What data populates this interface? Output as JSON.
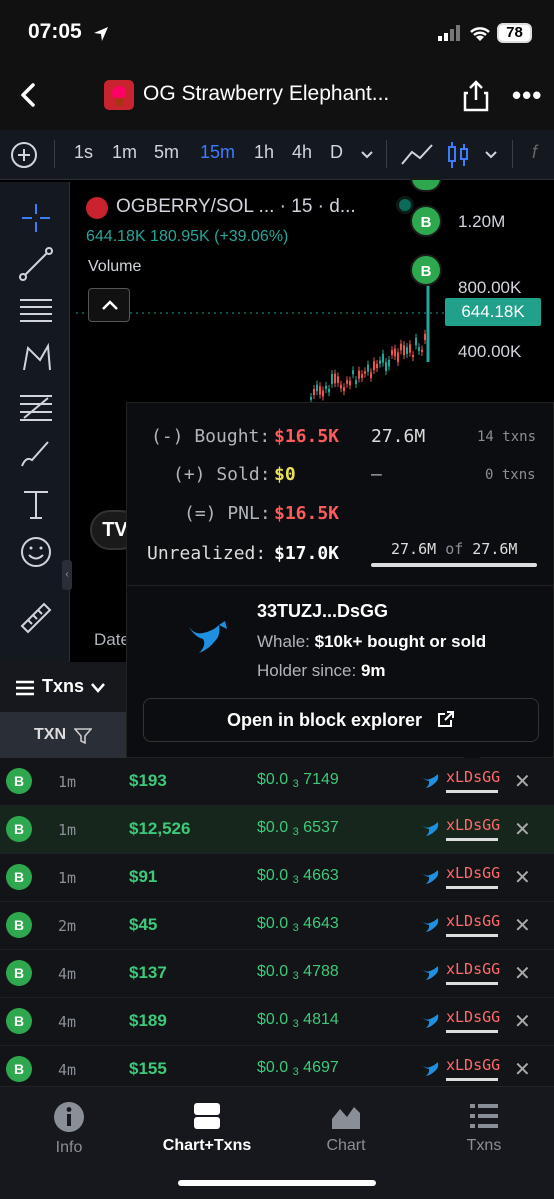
{
  "status_bar": {
    "time": "07:05",
    "battery": "78"
  },
  "header": {
    "title": "OG Strawberry Elephant..."
  },
  "toolbar": {
    "intervals": [
      "1s",
      "1m",
      "5m",
      "15m",
      "1h",
      "4h",
      "D"
    ],
    "active_interval": "15m"
  },
  "chart": {
    "pair_title": "OGBERRY/SOL ... · 15 · d...",
    "ohlc_text": "644.18K  180.95K (+39.06%)",
    "volume_label": "Volume",
    "y_labels": [
      "1.20M",
      "800.00K",
      "400.00K"
    ],
    "last_price": "644.18K",
    "buy_marker_label": "B",
    "date_label": "Date",
    "tv_logo": "TV"
  },
  "popup": {
    "bought_label": "(-) Bought:",
    "bought_value": "$16.5K",
    "bought_tokens": "27.6M",
    "bought_txns": "14 txns",
    "sold_label": "(+) Sold:",
    "sold_value": "$0",
    "sold_tokens": "–",
    "sold_txns": "0 txns",
    "pnl_label": "(=) PNL:",
    "pnl_value": "$16.5K",
    "unrealized_label": "Unrealized:",
    "unrealized_value": "$17.0K",
    "holding_a": "27.6M",
    "holding_of": "of",
    "holding_b": "27.6M",
    "address": "33TUZJ...DsGG",
    "whale_prefix": "Whale: ",
    "whale_value": "$10k+ bought or sold",
    "holder_prefix": "Holder since: ",
    "holder_value": "9m",
    "explorer_button": "Open in block explorer"
  },
  "txns": {
    "tab_label": "Txns",
    "column_label": "TXN",
    "rows": [
      {
        "type": "B",
        "age": "1m",
        "amount": "$193",
        "price_pre": "$0.0",
        "price_sub": "3",
        "price_post": "7149",
        "maker": "xLDsGG"
      },
      {
        "type": "B",
        "age": "1m",
        "amount": "$12,526",
        "price_pre": "$0.0",
        "price_sub": "3",
        "price_post": "6537",
        "maker": "xLDsGG"
      },
      {
        "type": "B",
        "age": "1m",
        "amount": "$91",
        "price_pre": "$0.0",
        "price_sub": "3",
        "price_post": "4663",
        "maker": "xLDsGG"
      },
      {
        "type": "B",
        "age": "2m",
        "amount": "$45",
        "price_pre": "$0.0",
        "price_sub": "3",
        "price_post": "4643",
        "maker": "xLDsGG"
      },
      {
        "type": "B",
        "age": "4m",
        "amount": "$137",
        "price_pre": "$0.0",
        "price_sub": "3",
        "price_post": "4788",
        "maker": "xLDsGG"
      },
      {
        "type": "B",
        "age": "4m",
        "amount": "$189",
        "price_pre": "$0.0",
        "price_sub": "3",
        "price_post": "4814",
        "maker": "xLDsGG"
      },
      {
        "type": "B",
        "age": "4m",
        "amount": "$155",
        "price_pre": "$0.0",
        "price_sub": "3",
        "price_post": "4697",
        "maker": "xLDsGG"
      }
    ]
  },
  "bottom_nav": {
    "items": [
      "Info",
      "Chart+Txns",
      "Chart",
      "Txns"
    ],
    "active": "Chart+Txns"
  },
  "colors": {
    "buy_green": "#2ea84f",
    "loss_red": "#ff5b5b",
    "accent_blue": "#3d7bff",
    "price_teal": "#21a08c"
  }
}
